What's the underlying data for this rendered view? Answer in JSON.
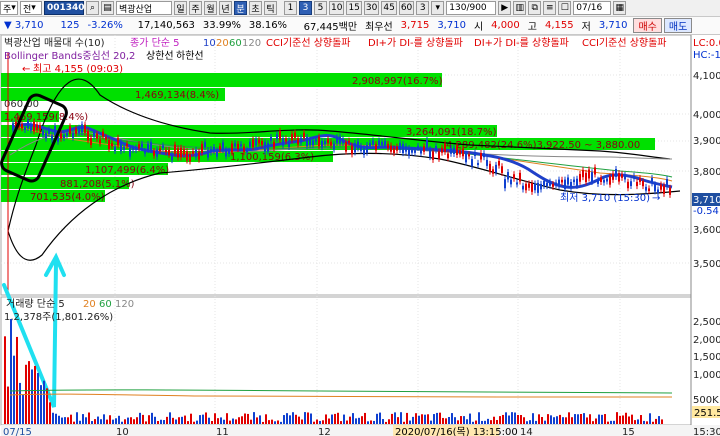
{
  "toolbar": {
    "menu_left": "주",
    "prev_label": "전",
    "stock_code": "001340",
    "search_icon": "magnifier-icon",
    "stock_name": "벽광산업",
    "periods": [
      "일",
      "주",
      "월",
      "년",
      "분",
      "초",
      "틱"
    ],
    "active_period": "분",
    "intervals": [
      "1",
      "3",
      "5",
      "10",
      "15",
      "30",
      "45",
      "60",
      "3"
    ],
    "active_interval": "3",
    "count": "130/900",
    "date": "07/16"
  },
  "quote": {
    "price": "3,710",
    "change": "125",
    "change_rate": "-3.26%",
    "volume": "17,140,563",
    "turnover": "33.99%",
    "ratio": "38.16%",
    "amount": "67,445백만",
    "best_label": "최우선",
    "ask1": "3,715",
    "bid1": "3,710",
    "open_label": "시",
    "open": "4,000",
    "high_label": "고",
    "high": "4,155",
    "low_label": "저",
    "low": "3,710",
    "buy_label": "매수",
    "sell_label": "매도"
  },
  "legend": {
    "top": "벽광산업 매물대 수(10)",
    "ma": "종가 단순 5",
    "ma_periods": [
      "10",
      "20",
      "60",
      "120"
    ],
    "ind1": "CCI기준선 상향돌파",
    "ind2": "DI+가 DI-를 상향돌파",
    "ind3": "DI+가 DI-를 상향돌파",
    "ind4": "CCI기준선 상향돌파",
    "bb": "Bollinger Bands중심선 20,2",
    "bb_upper": "상한선",
    "bb_lower": "하한선",
    "lc": "LC:0.0",
    "hc": "HC:-10"
  },
  "annotations": {
    "max_label": "최고 4,155 (09:03)",
    "min_label": "최저 3,710 (15:30)",
    "current": "3,710",
    "current_change": "-0.54"
  },
  "volume_profile": [
    "2,908,997(16.7%)",
    "1,469,134(8.4%)",
    "3,264,091(18.7%)",
    "4,289,482(24.6%)3,922.50 ~ 3,880.00",
    "1,107,499(6.4%)",
    "881,208(5.1%)",
    "701,535(4.0%)",
    "1,100,159(6.3%)",
    "1,469,159(8.4%)",
    "060.00",
    "1,700,159(9.8%)"
  ],
  "y_axis": [
    "4,100",
    "4,000",
    "3,900",
    "3,800",
    "3,600",
    "3,500"
  ],
  "volume_panel": {
    "title": "거래량 단순 5",
    "ma_periods": [
      "20",
      "60",
      "120"
    ],
    "summary": "1,2,378주(1,801.26%)",
    "axis": [
      "2,500K",
      "2,000K",
      "1,500K",
      "1,000K",
      "500K"
    ],
    "last_value": "251.5"
  },
  "x_axis": [
    "07/15",
    "10",
    "11",
    "12",
    "13",
    "14",
    "15",
    "15:30"
  ],
  "crosshair_label": "2020/07/16(목) 13:15:00",
  "colors": {
    "up": "#e00000",
    "down": "#1040d0",
    "profile": "#00e000",
    "ma5": "#2040c8"
  }
}
